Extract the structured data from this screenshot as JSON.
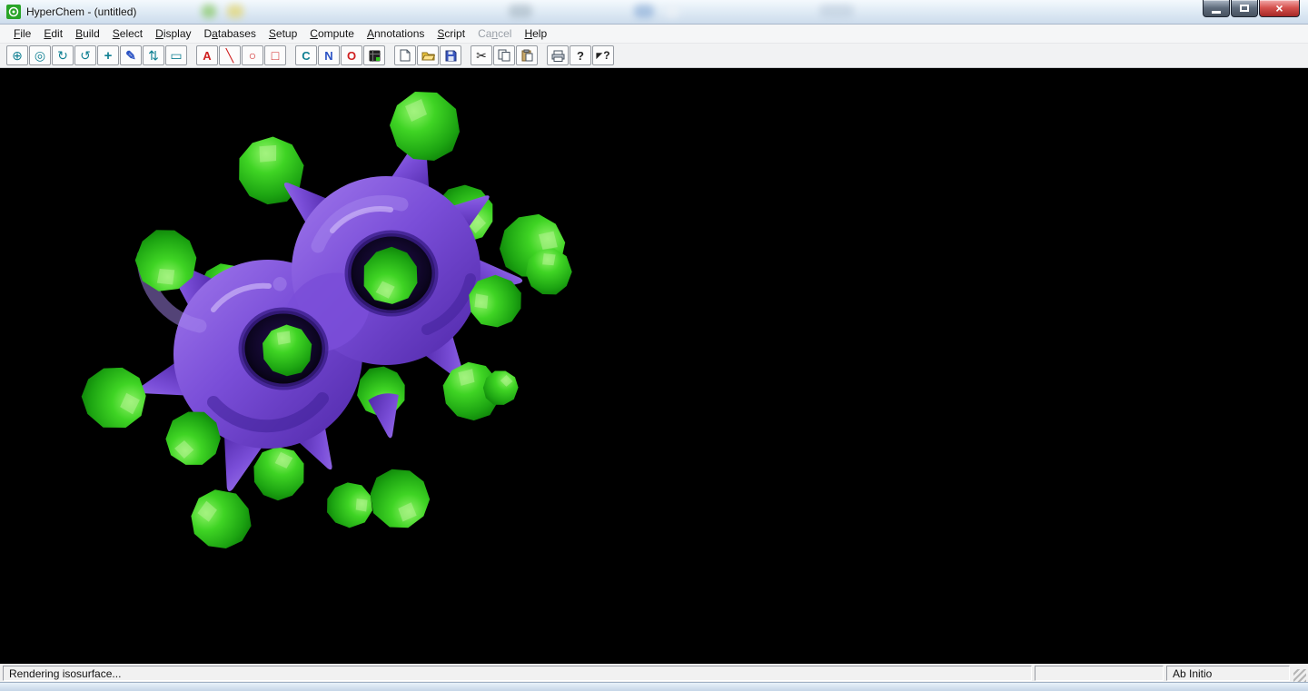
{
  "window": {
    "title": "HyperChem - (untitled)",
    "buttons": [
      "minimize",
      "maximize",
      "close"
    ],
    "close_glyph": "×"
  },
  "menu": {
    "items": [
      {
        "id": "file",
        "pre": "",
        "key": "F",
        "post": "ile",
        "enabled": true
      },
      {
        "id": "edit",
        "pre": "",
        "key": "E",
        "post": "dit",
        "enabled": true
      },
      {
        "id": "build",
        "pre": "",
        "key": "B",
        "post": "uild",
        "enabled": true
      },
      {
        "id": "select",
        "pre": "",
        "key": "S",
        "post": "elect",
        "enabled": true
      },
      {
        "id": "display",
        "pre": "",
        "key": "D",
        "post": "isplay",
        "enabled": true
      },
      {
        "id": "databases",
        "pre": "D",
        "key": "a",
        "post": "tabases",
        "enabled": true
      },
      {
        "id": "setup",
        "pre": "",
        "key": "S",
        "post": "etup",
        "enabled": true
      },
      {
        "id": "compute",
        "pre": "",
        "key": "C",
        "post": "ompute",
        "enabled": true
      },
      {
        "id": "annotations",
        "pre": "",
        "key": "A",
        "post": "nnotations",
        "enabled": true
      },
      {
        "id": "script",
        "pre": "",
        "key": "S",
        "post": "cript",
        "enabled": true
      },
      {
        "id": "cancel",
        "pre": "Ca",
        "key": "n",
        "post": "cel",
        "enabled": false
      },
      {
        "id": "help",
        "pre": "",
        "key": "H",
        "post": "elp",
        "enabled": true
      }
    ]
  },
  "toolbar": {
    "tools": [
      {
        "name": "select-tool",
        "glyph": "⊕"
      },
      {
        "name": "rotate-out-tool",
        "glyph": "◎"
      },
      {
        "name": "z-rotate-tool",
        "glyph": "↻"
      },
      {
        "name": "rotate-in-plane-tool",
        "glyph": "↺"
      },
      {
        "name": "translate-tool",
        "glyph": "+"
      },
      {
        "name": "draw-tool",
        "glyph": "✎"
      },
      {
        "name": "z-translate-tool",
        "glyph": "⇅"
      },
      {
        "name": "z-clip-tool",
        "glyph": "▭"
      }
    ],
    "annotations": [
      {
        "name": "annotation-text",
        "glyph": "A"
      },
      {
        "name": "annotation-line",
        "glyph": "╲"
      },
      {
        "name": "annotation-circle",
        "glyph": "○"
      },
      {
        "name": "annotation-rectangle",
        "glyph": "□"
      }
    ],
    "elements": [
      {
        "name": "element-carbon",
        "glyph": "C"
      },
      {
        "name": "element-nitrogen",
        "glyph": "N"
      },
      {
        "name": "element-oxygen",
        "glyph": "O"
      },
      {
        "name": "periodic-table",
        "glyph": ""
      }
    ],
    "file_buttons": [
      "new-document",
      "open-file",
      "save-file"
    ],
    "edit_buttons": [
      {
        "name": "cut",
        "glyph": "✂"
      },
      {
        "name": "copy"
      },
      {
        "name": "paste"
      }
    ],
    "misc_buttons": [
      {
        "name": "print"
      },
      {
        "name": "help",
        "glyph": "?"
      },
      {
        "name": "context-help",
        "glyph": "?"
      }
    ]
  },
  "statusbar": {
    "message": "Rendering isosurface...",
    "center": "",
    "method": "Ab Initio"
  },
  "colors": {
    "canvas_background": "#000000",
    "isosurface_positive_phase": "#7a4ed8",
    "isosurface_negative_phase": "#2ec61b"
  }
}
